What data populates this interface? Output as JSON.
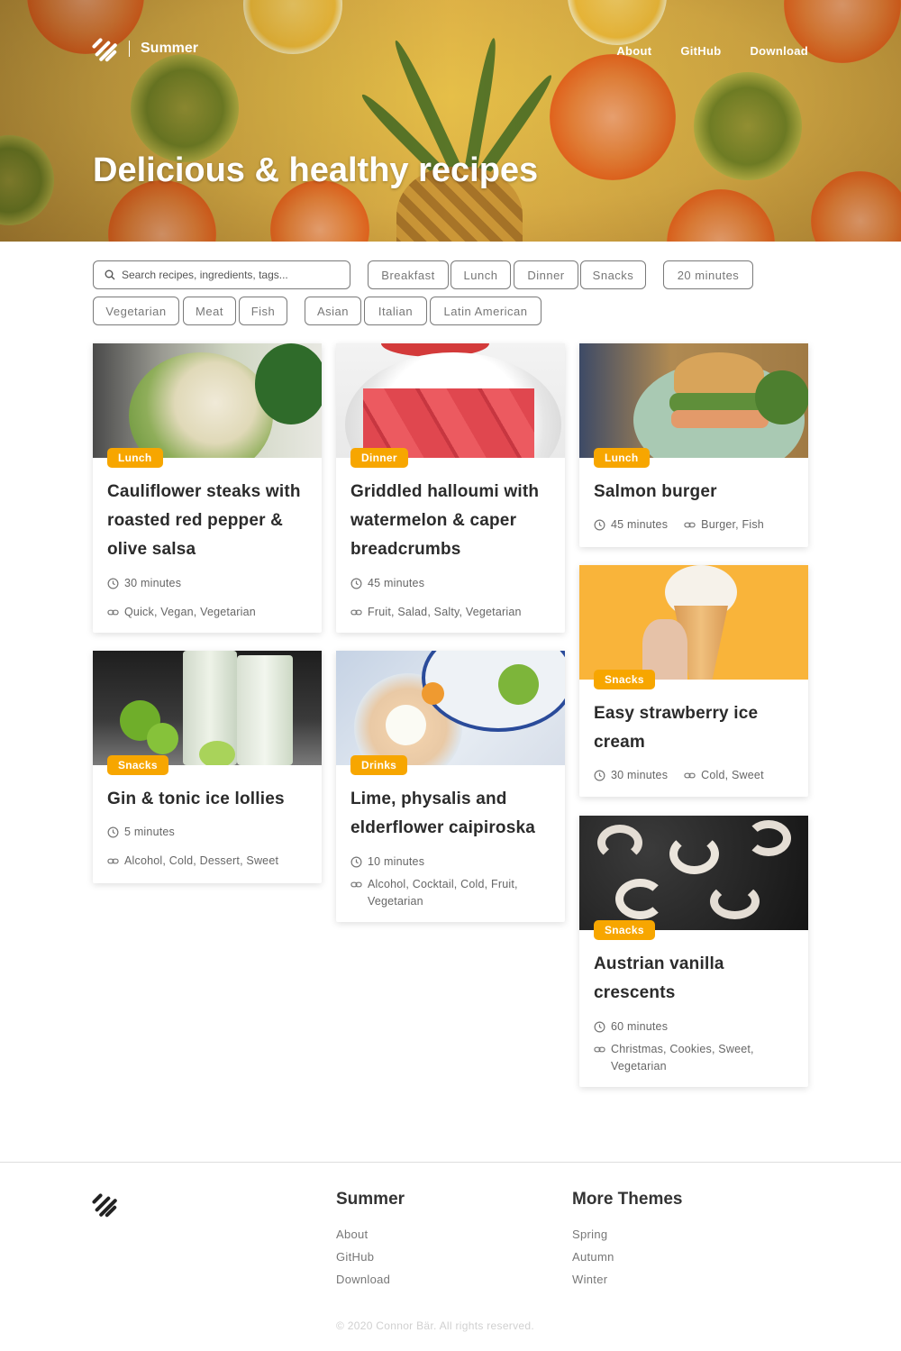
{
  "header": {
    "brand": "Summer",
    "nav": [
      "About",
      "GitHub",
      "Download"
    ],
    "title": "Delicious & healthy recipes"
  },
  "search": {
    "placeholder": "Search recipes, ingredients, tags..."
  },
  "filters": {
    "meal": [
      "Breakfast",
      "Lunch",
      "Dinner",
      "Snacks"
    ],
    "time": [
      "20 minutes"
    ],
    "diet": [
      "Vegetarian",
      "Meat",
      "Fish"
    ],
    "cuisine": [
      "Asian",
      "Italian",
      "Latin American"
    ]
  },
  "recipes": [
    {
      "category": "Lunch",
      "title": "Cauliflower steaks with roasted red pepper & olive salsa",
      "time": "30 minutes",
      "tags": "Quick, Vegan, Vegetarian"
    },
    {
      "category": "Dinner",
      "title": "Griddled halloumi with watermelon & caper breadcrumbs",
      "time": "45 minutes",
      "tags": "Fruit, Salad, Salty, Vegetarian"
    },
    {
      "category": "Lunch",
      "title": "Salmon burger",
      "time": "45 minutes",
      "tags": "Burger, Fish"
    },
    {
      "category": "Snacks",
      "title": "Gin & tonic ice lollies",
      "time": "5 minutes",
      "tags": "Alcohol, Cold, Dessert, Sweet"
    },
    {
      "category": "Drinks",
      "title": "Lime, physalis and elderflower caipiroska",
      "time": "10 minutes",
      "tags": "Alcohol, Cocktail, Cold, Fruit, Vegetarian"
    },
    {
      "category": "Snacks",
      "title": "Easy strawberry ice cream",
      "time": "30 minutes",
      "tags": "Cold, Sweet"
    },
    {
      "category": "Snacks",
      "title": "Austrian vanilla crescents",
      "time": "60 minutes",
      "tags": "Christmas, Cookies, Sweet, Vegetarian"
    }
  ],
  "footer": {
    "col1": {
      "heading": "Summer",
      "links": [
        "About",
        "GitHub",
        "Download"
      ]
    },
    "col2": {
      "heading": "More Themes",
      "links": [
        "Spring",
        "Autumn",
        "Winter"
      ]
    },
    "copyright": "© 2020 Connor Bär. All rights reserved."
  },
  "colors": {
    "accent": "#f7a600",
    "text": "#333333",
    "muted": "#777777"
  }
}
